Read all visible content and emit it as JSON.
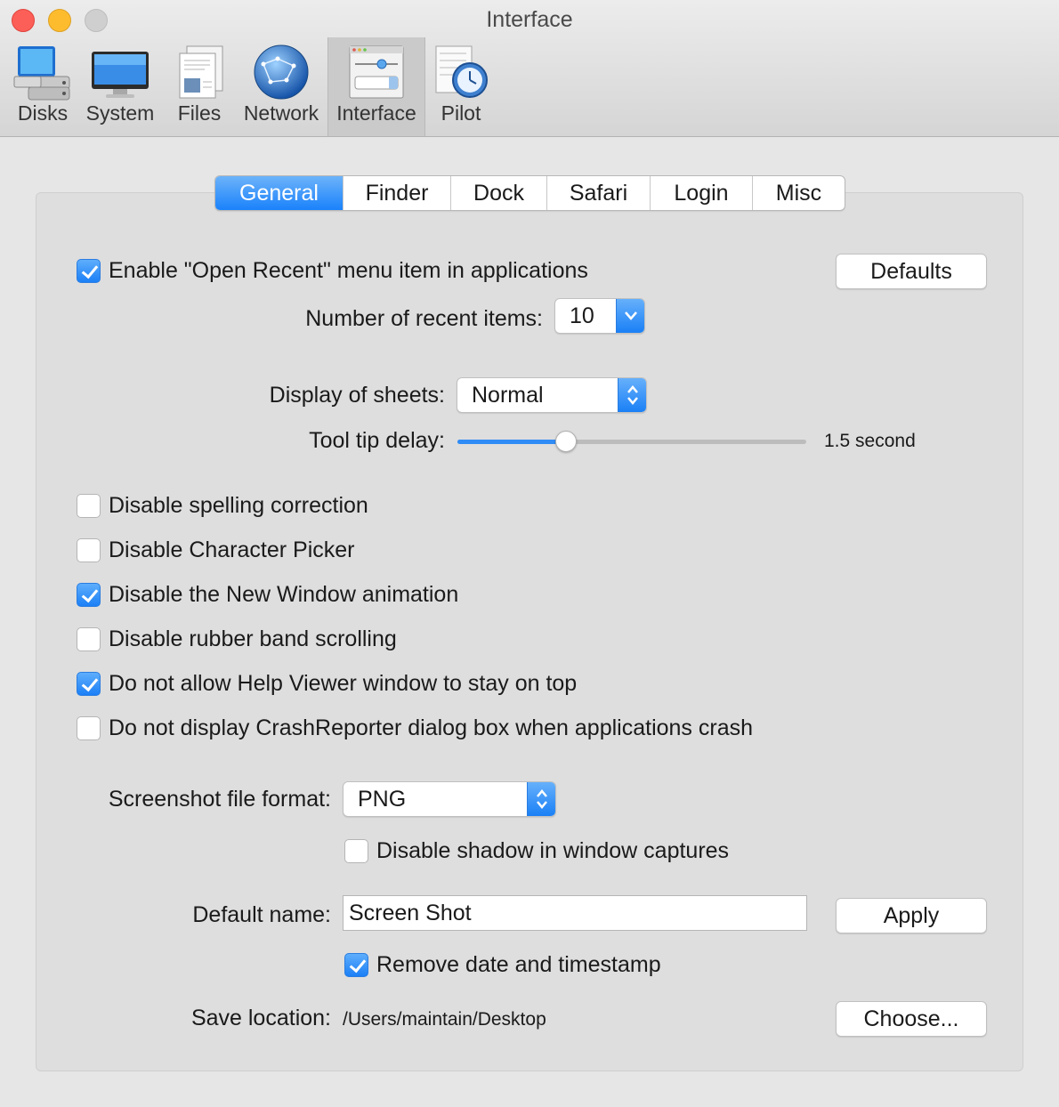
{
  "window": {
    "title": "Interface"
  },
  "toolbar": {
    "items": [
      {
        "label": "Disks",
        "icon": "disks-icon",
        "selected": false
      },
      {
        "label": "System",
        "icon": "monitor-icon",
        "selected": false
      },
      {
        "label": "Files",
        "icon": "files-icon",
        "selected": false
      },
      {
        "label": "Network",
        "icon": "network-globe-icon",
        "selected": false
      },
      {
        "label": "Interface",
        "icon": "interface-icon",
        "selected": true
      },
      {
        "label": "Pilot",
        "icon": "pilot-clock-icon",
        "selected": false
      }
    ]
  },
  "tabs": [
    {
      "label": "General",
      "active": true
    },
    {
      "label": "Finder",
      "active": false
    },
    {
      "label": "Dock",
      "active": false
    },
    {
      "label": "Safari",
      "active": false
    },
    {
      "label": "Login",
      "active": false
    },
    {
      "label": "Misc",
      "active": false
    }
  ],
  "general": {
    "open_recent": {
      "label": "Enable \"Open Recent\" menu item in applications",
      "checked": true
    },
    "defaults_button": "Defaults",
    "recent_items": {
      "label": "Number of recent items:",
      "value": "10"
    },
    "sheets": {
      "label": "Display of sheets:",
      "value": "Normal"
    },
    "tooltip": {
      "label": "Tool tip delay:",
      "value_text": "1.5 second",
      "slider_fraction": 0.31
    },
    "checkboxes": [
      {
        "label": "Disable spelling correction",
        "checked": false
      },
      {
        "label": "Disable Character Picker",
        "checked": false
      },
      {
        "label": "Disable the New Window animation",
        "checked": true
      },
      {
        "label": "Disable rubber band scrolling",
        "checked": false
      },
      {
        "label": "Do not allow Help Viewer window to stay on top",
        "checked": true
      },
      {
        "label": "Do not display CrashReporter dialog box when applications crash",
        "checked": false
      }
    ],
    "screenshot": {
      "format_label": "Screenshot file format:",
      "format_value": "PNG",
      "shadow": {
        "label": "Disable shadow in window captures",
        "checked": false
      },
      "name_label": "Default name:",
      "name_value": "Screen Shot",
      "apply_button": "Apply",
      "timestamp": {
        "label": "Remove date and timestamp",
        "checked": true
      },
      "location_label": "Save location:",
      "location_value": "/Users/maintain/Desktop",
      "choose_button": "Choose..."
    }
  },
  "colors": {
    "accent": "#1a82fb",
    "close": "#fc5f57",
    "minimize": "#fdbc2e"
  }
}
